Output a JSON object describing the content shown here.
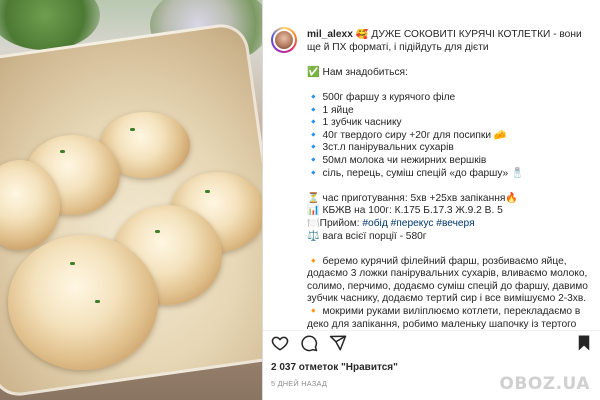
{
  "post": {
    "username": "mil_alexx",
    "caption_lines": [
      "🥰 ДУЖЕ СОКОВИТІ КУРЯЧІ КОТЛЕТКИ - вони ще й ПХ форматі, і підійдуть для дієти",
      "",
      "✅ Нам знадобиться:",
      "",
      "🔹 500г фаршу з курячого філе",
      "🔹 1 яйце",
      "🔹 1 зубчик часнику",
      "🔹 40г твердого сиру +20г для посипки 🧀",
      "🔹 3ст.л панірувальних сухарів",
      "🔹 50мл молока чи нежирних вершків",
      "🔹 сіль, перець, суміш спецій «до фаршу» 🧂",
      "",
      "⏳ час приготування: 5хв +25хв запікання🔥",
      "📊 КБЖВ на 100г: К.175 Б.17.3 Ж.9.2 В. 5",
      "🍽️Прийом: #обід #перекус #вечеря",
      "⚖️ вага всієї порції - 580г",
      "",
      "🔸 беремо курячий філейний фарш, розбиваємо яйце, додаємо 3 ложки панірувальних сухарів, вливаємо молоко, солимо, перчимо, додаємо суміш спецій до фаршу, давимо зубчик часнику, додаємо тертий сир і все вимішуємо 2-3хв.",
      "🔸 мокрими руками виліплюємо котлети, перекладаємо в деко для запікання, робимо маленьку шапочку із тертого сиру."
    ],
    "likes_text": "2 037 отметок \"Нравится\"",
    "time_text": "5 ДНЕЙ НАЗАД",
    "watermark": "OBOZ.UA"
  },
  "icons": {
    "like": "heart-icon",
    "comment": "comment-icon",
    "share": "share-icon",
    "save": "bookmark-icon"
  },
  "colors": {
    "text": "#262626",
    "hashtag": "#00376b",
    "muted": "#8e8e8e",
    "divider": "#efefef"
  }
}
